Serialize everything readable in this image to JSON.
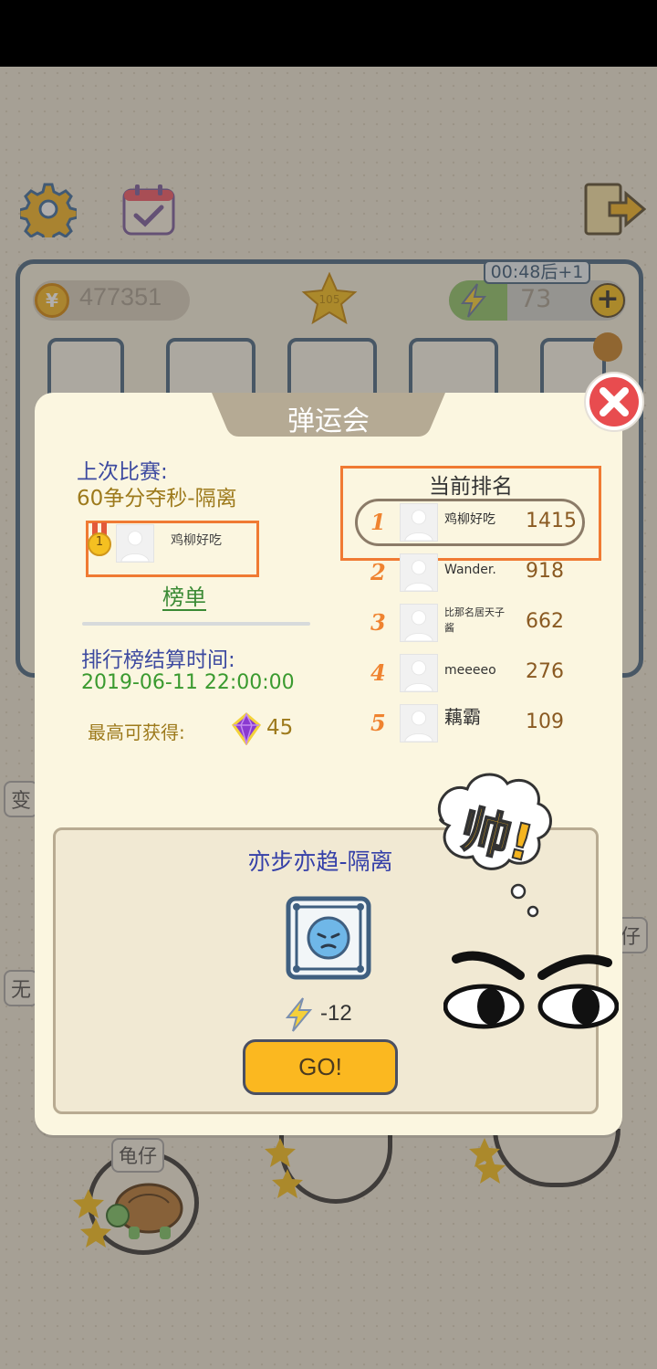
{
  "background": {
    "coins": "477351",
    "star_level": "105",
    "energy_timer": "00:48后+1",
    "energy": "73",
    "energy_level": 0.33,
    "side_chips": [
      "变",
      "无",
      "仔"
    ],
    "character_label": "龟仔"
  },
  "modal": {
    "title": "弹运会",
    "last_match_label": "上次比赛:",
    "last_match_name": "60争分夺秒-隔离",
    "my_medal": "1",
    "my_name": "鸡柳好吃",
    "leaderboard_link": "榜单",
    "settle_label": "排行榜结算时间:",
    "settle_time": "2019-06-11 22:00:00",
    "max_reward_label": "最高可获得:",
    "max_reward_value": "45",
    "current_rank_title": "当前排名",
    "ranking": [
      {
        "rank": "1",
        "name": "鸡柳好吃",
        "score": "1415"
      },
      {
        "rank": "2",
        "name": "Wander.",
        "score": "918"
      },
      {
        "rank": "3",
        "name": "比那名居天子酱",
        "score": "662"
      },
      {
        "rank": "4",
        "name": "meeeeo",
        "score": "276"
      },
      {
        "rank": "5",
        "name": "藕霸",
        "score": "109"
      }
    ],
    "event_name": "亦步亦趋-隔离",
    "cost": "-12",
    "go_label": "GO!",
    "sticker_text": "帅!"
  }
}
